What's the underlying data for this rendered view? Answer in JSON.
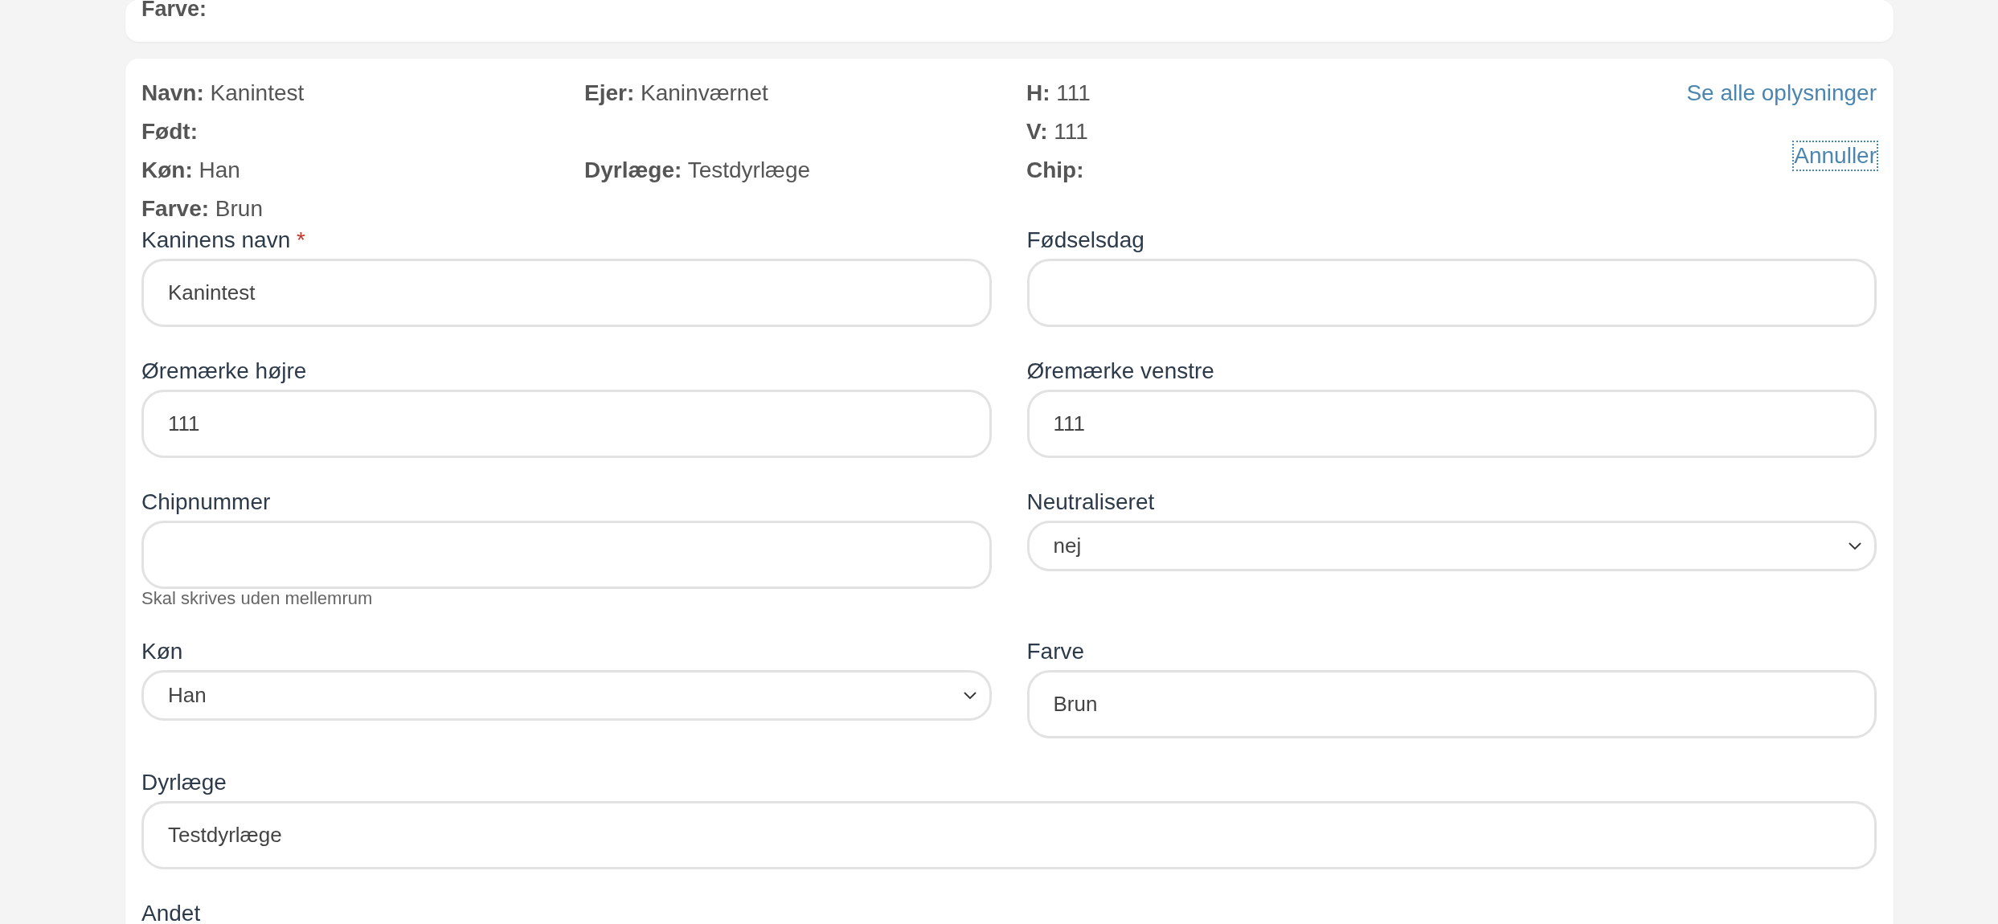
{
  "previous_card": {
    "label": "Farve:"
  },
  "summary_rows": [
    {
      "cells": [
        {
          "label": "Navn:",
          "value": "Kanintest"
        },
        {
          "label": "Ejer:",
          "value": "Kaninværnet"
        },
        {
          "label": "H:",
          "value": "111"
        }
      ]
    },
    {
      "cells": [
        {
          "label": "Født:"
        },
        null,
        {
          "label": "V:",
          "value": "111"
        }
      ]
    },
    {
      "cells": [
        {
          "label": "Køn:",
          "value": "Han"
        },
        {
          "label": "Dyrlæge:",
          "value": "Testdyrlæge"
        },
        {
          "label": "Chip:"
        }
      ]
    },
    {
      "cells": [
        {
          "label": "Farve:",
          "value": "Brun"
        },
        null,
        null
      ]
    }
  ],
  "links": [
    {
      "label": "Se alle oplysninger",
      "focused": false
    },
    {
      "label": "Annuller",
      "focused": true
    }
  ],
  "fields": [
    {
      "kind": "text",
      "label": "Kaninens navn",
      "required_mark": "*",
      "value": "Kanintest"
    },
    {
      "kind": "text",
      "label": "Fødselsdag"
    },
    {
      "kind": "text",
      "label": "Øremærke højre",
      "value": "111"
    },
    {
      "kind": "text",
      "label": "Øremærke venstre",
      "value": "111"
    },
    {
      "kind": "text",
      "label": "Chipnummer",
      "hint": "Skal skrives uden mellemrum"
    },
    {
      "kind": "select",
      "label": "Neutraliseret",
      "value": "nej"
    },
    {
      "kind": "select",
      "label": "Køn",
      "value": "Han"
    },
    {
      "kind": "text",
      "label": "Farve",
      "value": "Brun"
    },
    {
      "kind": "text",
      "label": "Dyrlæge",
      "value": "Testdyrlæge",
      "wide": true
    },
    {
      "kind": "cut",
      "label": "Andet",
      "wide": true
    }
  ]
}
